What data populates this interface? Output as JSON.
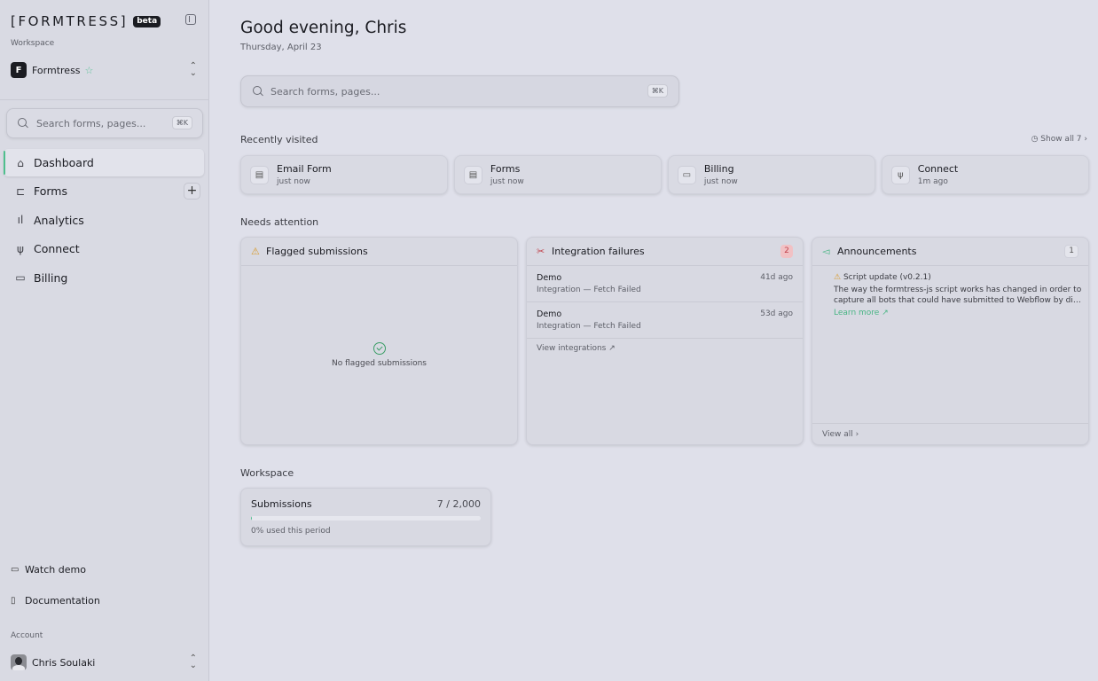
{
  "sidebar": {
    "logo": "[FORMTRESS]",
    "beta": "beta",
    "workspace_label": "Workspace",
    "workspace": {
      "avatar": "F",
      "name": "Formtress"
    },
    "search": {
      "placeholder": "Search forms, pages...",
      "shortcut": "⌘K"
    },
    "nav": [
      {
        "label": "Dashboard",
        "icon": "home-icon",
        "glyph": "⌂",
        "active": true
      },
      {
        "label": "Forms",
        "icon": "forms-icon",
        "glyph": "⊏",
        "active": false
      },
      {
        "label": "Analytics",
        "icon": "analytics-icon",
        "glyph": "ıl",
        "active": false
      },
      {
        "label": "Connect",
        "icon": "plug-icon",
        "glyph": "ψ",
        "active": false
      },
      {
        "label": "Billing",
        "icon": "tag-icon",
        "glyph": "▭",
        "active": false
      }
    ],
    "watch_demo": "Watch demo",
    "documentation": "Documentation",
    "account_label": "Account",
    "user_name": "Chris Soulaki"
  },
  "main": {
    "greeting": "Good evening, Chris",
    "date": "Thursday, April 23",
    "search": {
      "placeholder": "Search forms, pages...",
      "shortcut": "⌘K"
    },
    "recently_visited": {
      "title": "Recently visited",
      "show_all": "Show all 7",
      "items": [
        {
          "title": "Email Form",
          "sub": "just now",
          "icon": "document-icon",
          "glyph": "▤"
        },
        {
          "title": "Forms",
          "sub": "just now",
          "icon": "document-icon",
          "glyph": "▤"
        },
        {
          "title": "Billing",
          "sub": "just now",
          "icon": "card-icon",
          "glyph": "▭"
        },
        {
          "title": "Connect",
          "sub": "1m ago",
          "icon": "plug-icon",
          "glyph": "ψ"
        }
      ]
    },
    "needs_attention": {
      "title": "Needs attention",
      "flagged": {
        "title": "Flagged submissions",
        "empty": "No flagged submissions"
      },
      "integration_failures": {
        "title": "Integration failures",
        "count": "2",
        "items": [
          {
            "title": "Demo",
            "sub": "Integration — Fetch Failed",
            "age": "41d ago"
          },
          {
            "title": "Demo",
            "sub": "Integration — Fetch Failed",
            "age": "53d ago"
          }
        ],
        "view_link": "View integrations ↗"
      },
      "announcements": {
        "title": "Announcements",
        "count": "1",
        "item_title": "Script update (v0.2.1)",
        "item_text_1": "The way the formtress-js script works has changed in order to",
        "item_text_2": "capture all bots that could have submitted to Webflow by disabling the form",
        "learn_more": "Learn more ↗",
        "view_all": "View all ›"
      }
    },
    "workspace_section": {
      "title": "Workspace",
      "submissions": {
        "title": "Submissions",
        "value": "7 / 2,000",
        "sub": "0% used this period",
        "used_fraction": 0.0035
      }
    }
  },
  "colors": {
    "accent": "#4fbf8d",
    "danger": "#c1424b",
    "warning": "#d99a2b"
  }
}
